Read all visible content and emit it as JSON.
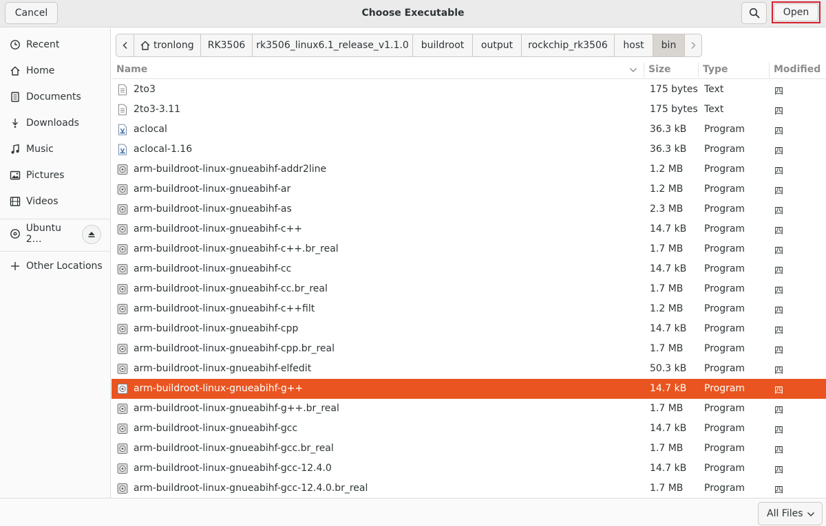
{
  "header": {
    "title": "Choose Executable",
    "cancel_label": "Cancel",
    "open_label": "Open"
  },
  "sidebar": {
    "items": [
      {
        "label": "Recent",
        "icon": "clock-icon"
      },
      {
        "label": "Home",
        "icon": "home-icon"
      },
      {
        "label": "Documents",
        "icon": "document-icon"
      },
      {
        "label": "Downloads",
        "icon": "download-icon"
      },
      {
        "label": "Music",
        "icon": "music-icon"
      },
      {
        "label": "Pictures",
        "icon": "picture-icon"
      },
      {
        "label": "Videos",
        "icon": "film-icon"
      },
      {
        "label": "Ubuntu 2…",
        "icon": "disc-icon"
      },
      {
        "label": "Other Locations",
        "icon": "plus-icon"
      }
    ]
  },
  "pathbar": {
    "segments": [
      "tronlong",
      "RK3506",
      "rk3506_linux6.1_release_v1.1.0",
      "buildroot",
      "output",
      "rockchip_rk3506",
      "host",
      "bin"
    ]
  },
  "columns": {
    "name": "Name",
    "size": "Size",
    "type": "Type",
    "modified": "Modified"
  },
  "files": [
    {
      "name": "2to3",
      "size": "175 bytes",
      "type": "Text",
      "modified": "四",
      "icon": "text-file-icon"
    },
    {
      "name": "2to3-3.11",
      "size": "175 bytes",
      "type": "Text",
      "modified": "四",
      "icon": "text-file-icon"
    },
    {
      "name": "aclocal",
      "size": "36.3 kB",
      "type": "Program",
      "modified": "四",
      "icon": "script-file-icon"
    },
    {
      "name": "aclocal-1.16",
      "size": "36.3 kB",
      "type": "Program",
      "modified": "四",
      "icon": "script-file-icon"
    },
    {
      "name": "arm-buildroot-linux-gnueabihf-addr2line",
      "size": "1.2 MB",
      "type": "Program",
      "modified": "四",
      "icon": "executable-icon"
    },
    {
      "name": "arm-buildroot-linux-gnueabihf-ar",
      "size": "1.2 MB",
      "type": "Program",
      "modified": "四",
      "icon": "executable-icon"
    },
    {
      "name": "arm-buildroot-linux-gnueabihf-as",
      "size": "2.3 MB",
      "type": "Program",
      "modified": "四",
      "icon": "executable-icon"
    },
    {
      "name": "arm-buildroot-linux-gnueabihf-c++",
      "size": "14.7 kB",
      "type": "Program",
      "modified": "四",
      "icon": "executable-icon"
    },
    {
      "name": "arm-buildroot-linux-gnueabihf-c++.br_real",
      "size": "1.7 MB",
      "type": "Program",
      "modified": "四",
      "icon": "executable-icon"
    },
    {
      "name": "arm-buildroot-linux-gnueabihf-cc",
      "size": "14.7 kB",
      "type": "Program",
      "modified": "四",
      "icon": "executable-icon"
    },
    {
      "name": "arm-buildroot-linux-gnueabihf-cc.br_real",
      "size": "1.7 MB",
      "type": "Program",
      "modified": "四",
      "icon": "executable-icon"
    },
    {
      "name": "arm-buildroot-linux-gnueabihf-c++filt",
      "size": "1.2 MB",
      "type": "Program",
      "modified": "四",
      "icon": "executable-icon"
    },
    {
      "name": "arm-buildroot-linux-gnueabihf-cpp",
      "size": "14.7 kB",
      "type": "Program",
      "modified": "四",
      "icon": "executable-icon"
    },
    {
      "name": "arm-buildroot-linux-gnueabihf-cpp.br_real",
      "size": "1.7 MB",
      "type": "Program",
      "modified": "四",
      "icon": "executable-icon"
    },
    {
      "name": "arm-buildroot-linux-gnueabihf-elfedit",
      "size": "50.3 kB",
      "type": "Program",
      "modified": "四",
      "icon": "executable-icon"
    },
    {
      "name": "arm-buildroot-linux-gnueabihf-g++",
      "size": "14.7 kB",
      "type": "Program",
      "modified": "四",
      "icon": "executable-icon",
      "selected": true
    },
    {
      "name": "arm-buildroot-linux-gnueabihf-g++.br_real",
      "size": "1.7 MB",
      "type": "Program",
      "modified": "四",
      "icon": "executable-icon"
    },
    {
      "name": "arm-buildroot-linux-gnueabihf-gcc",
      "size": "14.7 kB",
      "type": "Program",
      "modified": "四",
      "icon": "executable-icon"
    },
    {
      "name": "arm-buildroot-linux-gnueabihf-gcc.br_real",
      "size": "1.7 MB",
      "type": "Program",
      "modified": "四",
      "icon": "executable-icon"
    },
    {
      "name": "arm-buildroot-linux-gnueabihf-gcc-12.4.0",
      "size": "14.7 kB",
      "type": "Program",
      "modified": "四",
      "icon": "executable-icon"
    },
    {
      "name": "arm-buildroot-linux-gnueabihf-gcc-12.4.0.br_real",
      "size": "1.7 MB",
      "type": "Program",
      "modified": "四",
      "icon": "executable-icon"
    }
  ],
  "filter": {
    "label": "All Files"
  },
  "colors": {
    "selection": "#e95420",
    "open_highlight": "#d6202e"
  }
}
